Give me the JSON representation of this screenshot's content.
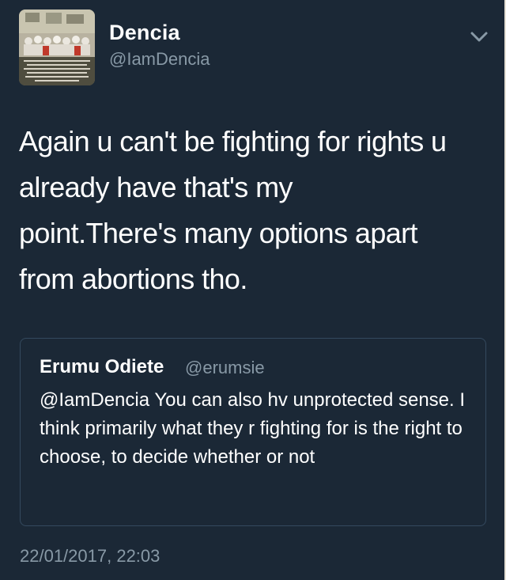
{
  "tweet": {
    "author_name": "Dencia",
    "author_handle": "@IamDencia",
    "avatar_icon": "profile-photo",
    "menu_icon": "chevron-down-icon",
    "text_lines": [
      "Again u can't be fighting for rights u",
      "already have that's my",
      "point.There's many options apart",
      "from abortions tho."
    ],
    "timestamp": "22/01/2017, 22:03"
  },
  "quoted_tweet": {
    "author_name": "Erumu Odiete",
    "author_handle": "@erumsie",
    "text": "@IamDencia You can also hv unprotected sense. I think primarily what they r fighting for is the right to choose, to decide whether or not"
  },
  "colors": {
    "background": "#1b2836",
    "primary_text": "#ffffff",
    "secondary_text": "#8899a6",
    "quote_border": "#34495e"
  }
}
